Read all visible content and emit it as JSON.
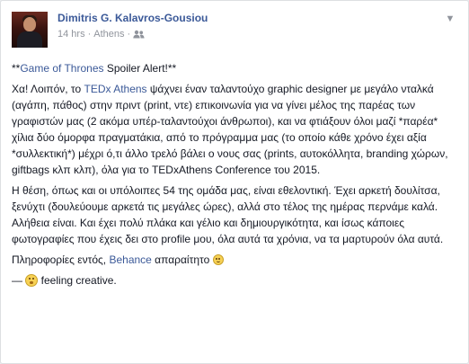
{
  "author": {
    "name": "Dimitris G. Kalavros-Gousiou",
    "time": "14 hrs",
    "separator": "·",
    "location": "Athens",
    "privacy_icon": "friends-icon"
  },
  "post": {
    "lead": {
      "prefix": "**",
      "link": "Game of Thrones",
      "suffix": " Spoiler Alert!**"
    },
    "para1": {
      "a": "Χα! Λοιπόν, το ",
      "link": "TEDx Athens",
      "b": " ψάχνει έναν ταλαντούχο graphic designer με μεγάλο νταλκά (αγάπη, πάθος) στην πριντ (print, ντε) επικοινωνία για να γίνει μέλος της παρέας των γραφιστών μας (2 ακόμα υπέρ-ταλαντούχοι άνθρωποι), και να φτιάξουν όλοι μαζί *παρέα* χίλια δύο όμορφα πραγματάκια, από το πρόγραμμα μας (το οποίο κάθε χρόνο έχει αξία *συλλεκτική*) μέχρι ό,τι άλλο τρελό βάλει ο νους σας (prints, αυτοκόλλητα, branding χώρων, giftbags κλπ κλπ), όλα για το TEDxAthens Conference του 2015."
    },
    "para2": "Η θέση, όπως και οι υπόλοιπες 54 της ομάδα μας, είναι εθελοντική. Έχει αρκετή δουλίτσα, ξενύχτι (δουλεύουμε αρκετά τις μεγάλες ώρες), αλλά στο τέλος της ημέρας περνάμε καλά. Αλήθεια είναι. Και έχει πολύ πλάκα και γέλιο και δημιουργικότητα, και ίσως κάποιες φωτογραφίες που έχεις δει στο profile μου, όλα αυτά τα χρόνια, να τα μαρτυρούν όλα αυτά.",
    "para3": {
      "a": "Πληροφορίες εντός, ",
      "link": "Behance",
      "b": " απαραίτητο "
    },
    "feeling": {
      "dash": "— ",
      "text": " feeling creative."
    }
  },
  "colors": {
    "link": "#3b5998",
    "text": "#141823",
    "meta": "#90949c"
  }
}
